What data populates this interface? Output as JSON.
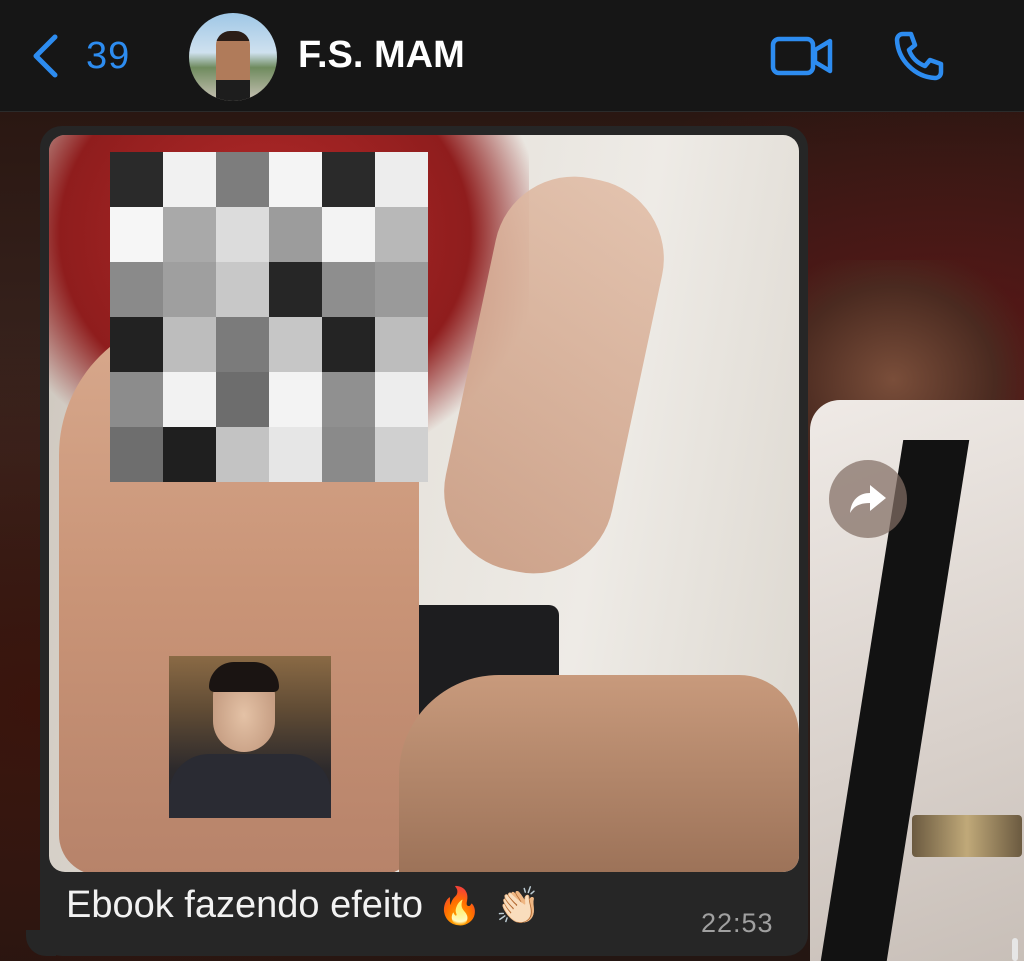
{
  "header": {
    "back_count": "39",
    "contact_name": "F.S. MAM",
    "accent_color": "#2d8cf0",
    "icons": [
      "back-chevron-icon",
      "video-call-icon",
      "phone-call-icon"
    ]
  },
  "message": {
    "caption": "Ebook fazendo efeito",
    "emojis": [
      "🔥",
      "👏🏻"
    ],
    "time": "22:53",
    "media_type": "photo (censored)",
    "forward_icon": "forward-arrow-icon"
  }
}
